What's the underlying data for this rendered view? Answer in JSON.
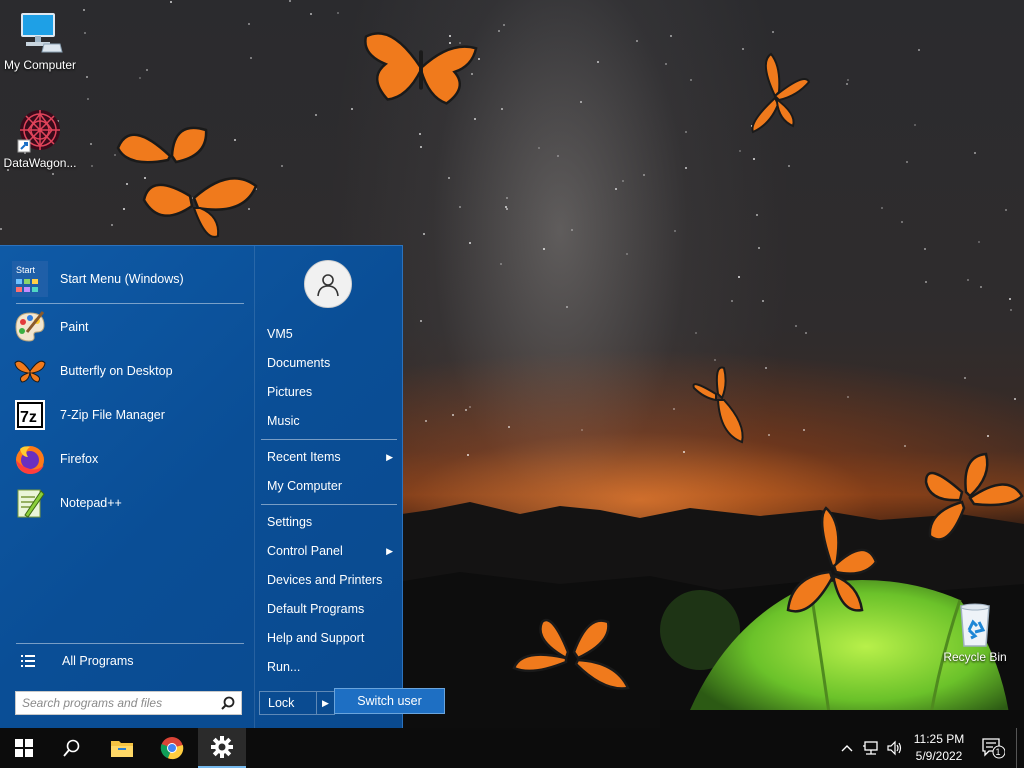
{
  "desktop": {
    "icons": [
      {
        "label": "My Computer"
      },
      {
        "label": "DataWagon..."
      },
      {
        "label": "Recycle Bin"
      }
    ]
  },
  "start_menu": {
    "programs": [
      {
        "label": "Start Menu (Windows)",
        "icon": "start-menu-icon"
      },
      {
        "label": "Paint",
        "icon": "paint-palette-icon"
      },
      {
        "label": "Butterfly on Desktop",
        "icon": "butterfly-icon"
      },
      {
        "label": "7-Zip File Manager",
        "icon": "seven-zip-icon"
      },
      {
        "label": "Firefox",
        "icon": "firefox-icon"
      },
      {
        "label": "Notepad++",
        "icon": "notepad-plus-plus-icon"
      }
    ],
    "start_icon_text": "Start",
    "seven_zip_icon_text": "7z",
    "all_programs": "All Programs",
    "search_placeholder": "Search programs and files",
    "user_items": [
      {
        "label": "VM5"
      },
      {
        "label": "Documents"
      },
      {
        "label": "Pictures"
      },
      {
        "label": "Music"
      }
    ],
    "places": [
      {
        "label": "Recent Items",
        "has_submenu": true
      },
      {
        "label": "My Computer",
        "has_submenu": false
      }
    ],
    "system_items": [
      {
        "label": "Settings",
        "has_submenu": false
      },
      {
        "label": "Control Panel",
        "has_submenu": true
      },
      {
        "label": "Devices and Printers",
        "has_submenu": false
      },
      {
        "label": "Default Programs",
        "has_submenu": false
      },
      {
        "label": "Help and Support",
        "has_submenu": false
      },
      {
        "label": "Run...",
        "has_submenu": false
      }
    ],
    "lock_label": "Lock",
    "switch_user_label": "Switch user"
  },
  "taskbar": {
    "time": "11:25 PM",
    "date": "5/9/2022",
    "notification_count": "1",
    "pinned": [
      "start-button",
      "search",
      "file-explorer",
      "chrome",
      "settings"
    ]
  },
  "colors": {
    "start_menu_bg": "#0a4e96",
    "taskbar_bg": "#0c0c0c",
    "switch_user_bg": "#1e6fc3",
    "butterfly_orange": "#f07a1c"
  }
}
